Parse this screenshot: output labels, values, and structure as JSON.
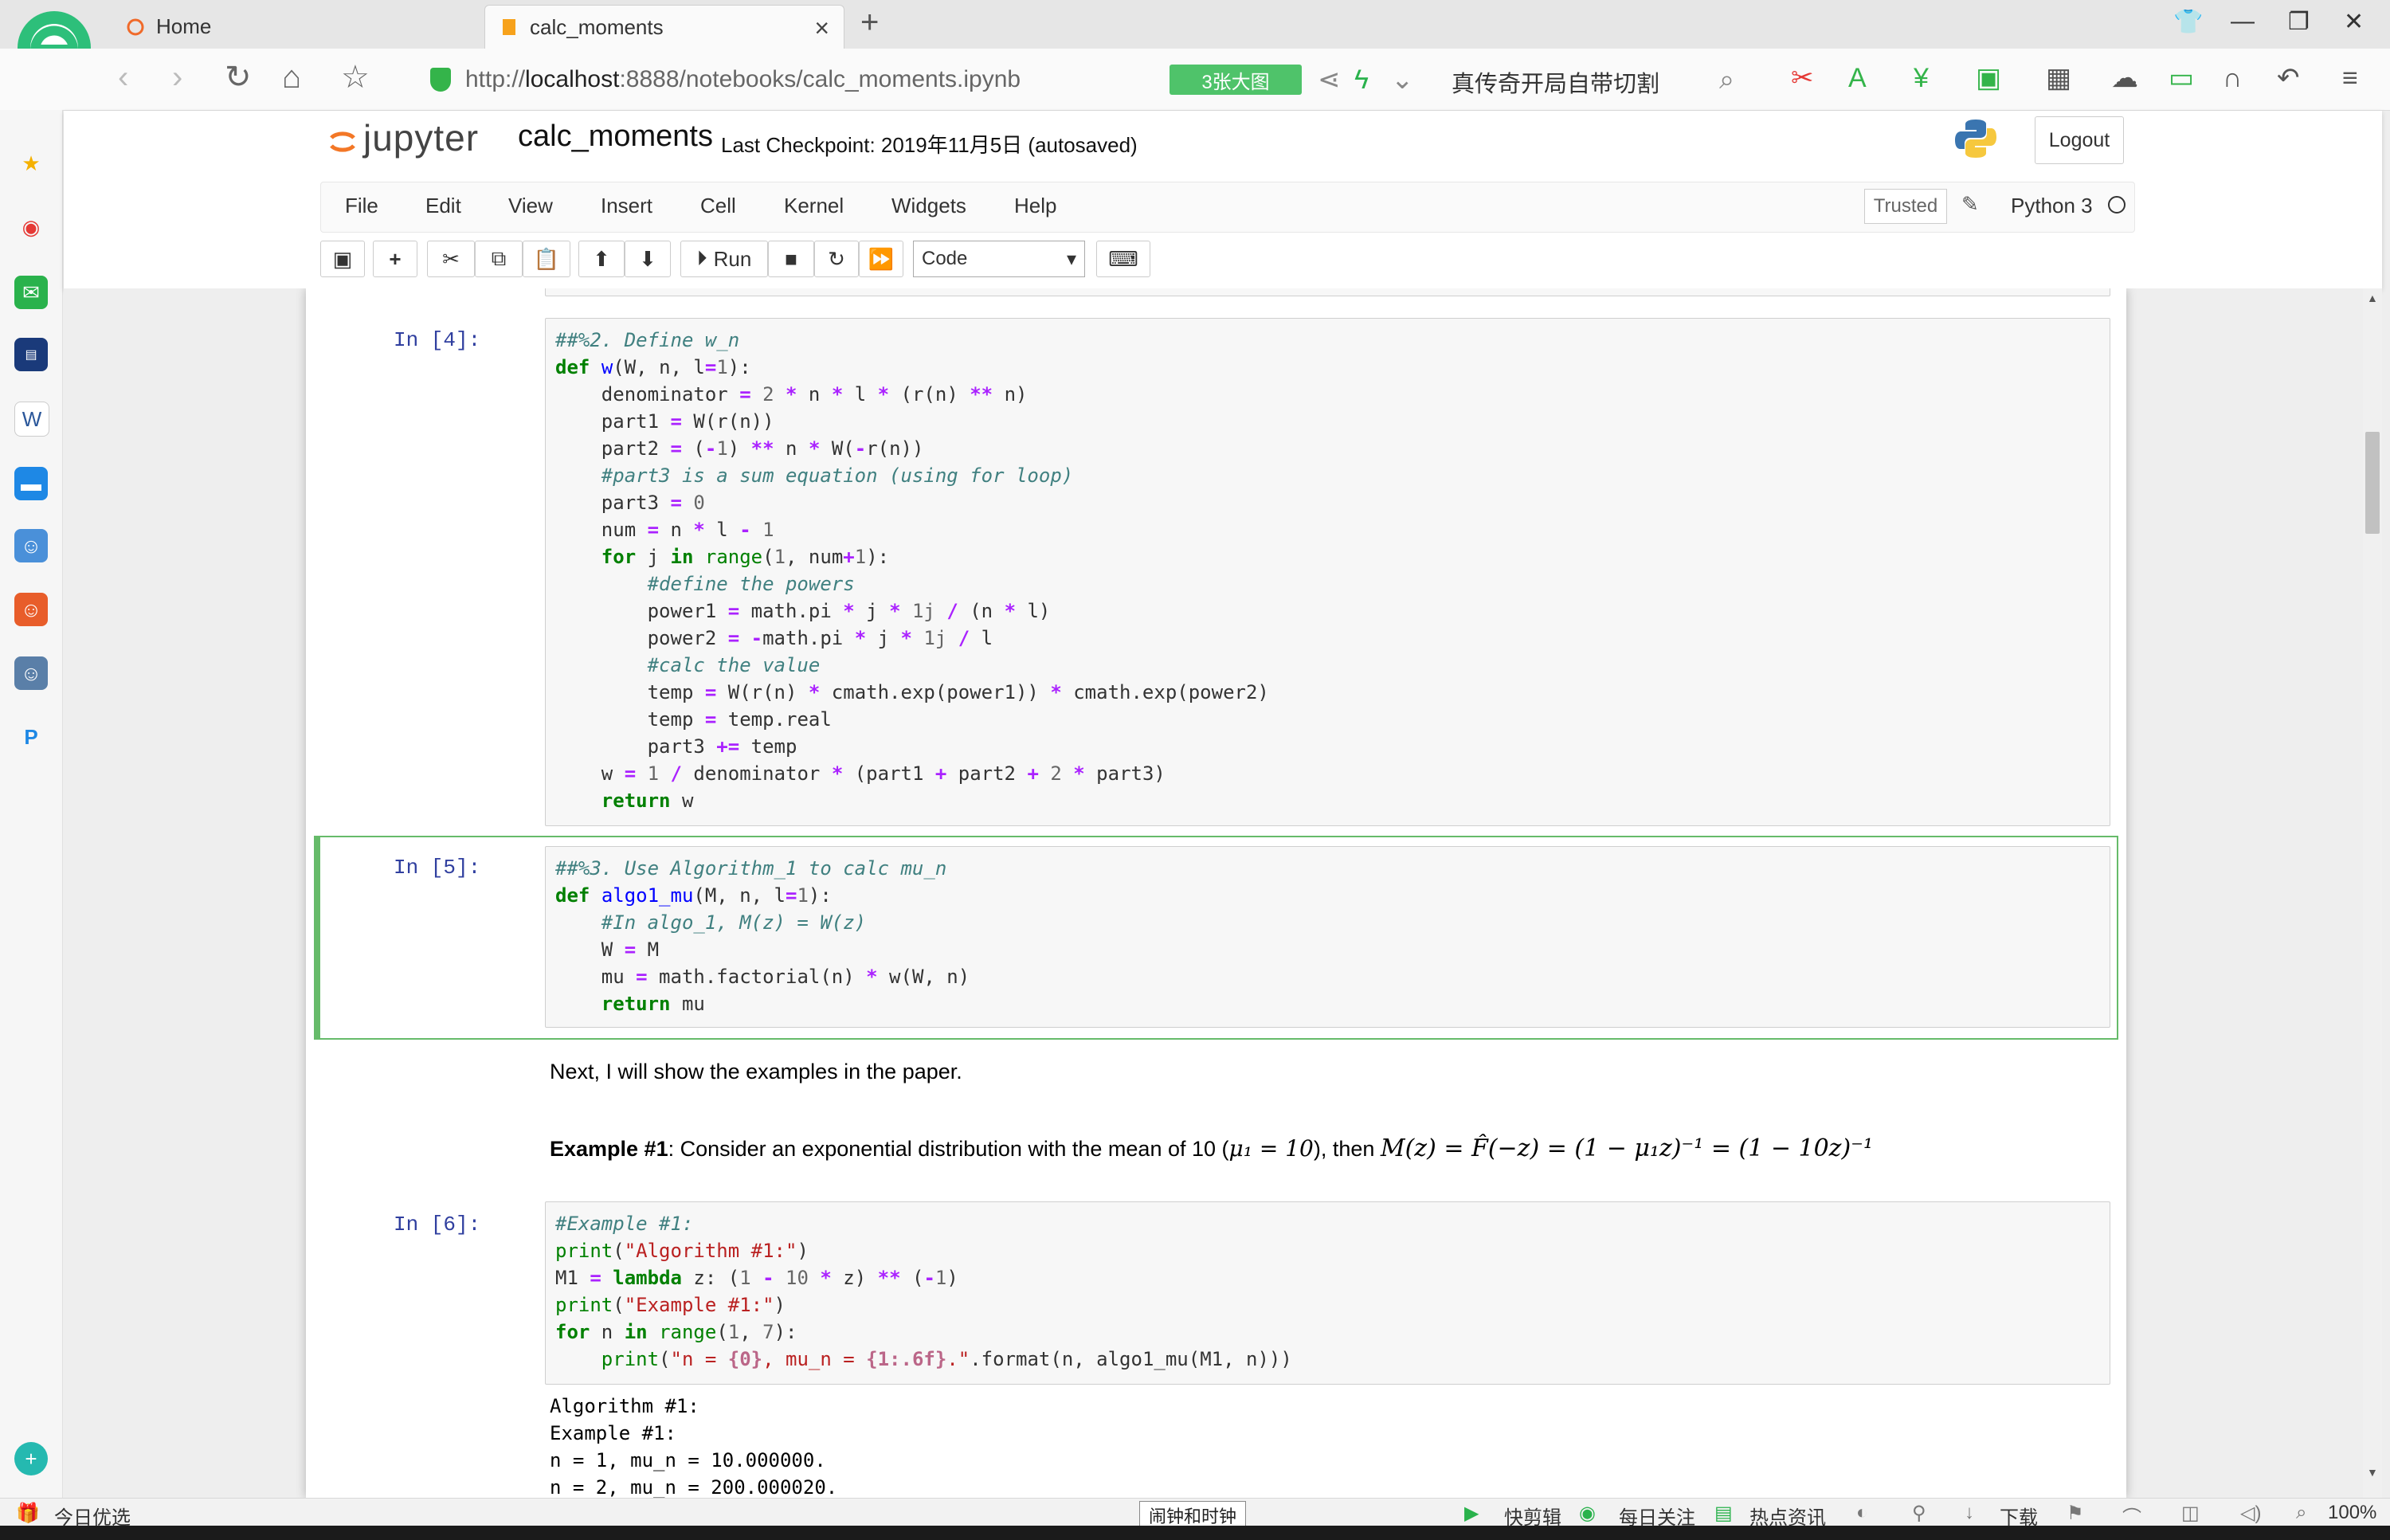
{
  "browser": {
    "tabs": [
      {
        "label": "Home"
      },
      {
        "label": "calc_moments"
      }
    ],
    "url_prefix": "http://",
    "url_host": "localhost",
    "url_rest": ":8888/notebooks/calc_moments.ipynb",
    "image_badge": "3张大图",
    "search_query": "真传奇开局自带切割"
  },
  "jupyter": {
    "logo_text": "jupyter",
    "notebook_name": "calc_moments",
    "checkpoint": "Last Checkpoint: 2019年11月5日   (autosaved)",
    "logout_label": "Logout",
    "menu": [
      "File",
      "Edit",
      "View",
      "Insert",
      "Cell",
      "Kernel",
      "Widgets",
      "Help"
    ],
    "trusted_label": "Trusted",
    "kernel_name": "Python 3",
    "toolbar": {
      "run_label": "Run",
      "cell_type": "Code"
    }
  },
  "cells": {
    "cell4": {
      "prompt": "In [4]:",
      "lines": [
        [
          [
            "c",
            "##%2. Define w_n"
          ]
        ],
        [
          [
            "k",
            "def"
          ],
          [
            "t",
            " "
          ],
          [
            "nf",
            "w"
          ],
          [
            "t",
            "(W, n, l"
          ],
          [
            "o",
            "="
          ],
          [
            "mi",
            "1"
          ],
          [
            "t",
            "):"
          ]
        ],
        [
          [
            "t",
            "    denominator "
          ],
          [
            "o",
            "="
          ],
          [
            "t",
            " "
          ],
          [
            "mi",
            "2"
          ],
          [
            "t",
            " "
          ],
          [
            "o",
            "*"
          ],
          [
            "t",
            " n "
          ],
          [
            "o",
            "*"
          ],
          [
            "t",
            " l "
          ],
          [
            "o",
            "*"
          ],
          [
            "t",
            " (r(n) "
          ],
          [
            "o",
            "**"
          ],
          [
            "t",
            " n)"
          ]
        ],
        [
          [
            "t",
            "    part1 "
          ],
          [
            "o",
            "="
          ],
          [
            "t",
            " W(r(n))"
          ]
        ],
        [
          [
            "t",
            "    part2 "
          ],
          [
            "o",
            "="
          ],
          [
            "t",
            " ("
          ],
          [
            "o",
            "-"
          ],
          [
            "mi",
            "1"
          ],
          [
            "t",
            ") "
          ],
          [
            "o",
            "**"
          ],
          [
            "t",
            " n "
          ],
          [
            "o",
            "*"
          ],
          [
            "t",
            " W("
          ],
          [
            "o",
            "-"
          ],
          [
            "t",
            "r(n))"
          ]
        ],
        [
          [
            "t",
            "    "
          ],
          [
            "c",
            "#part3 is a sum equation (using for loop)"
          ]
        ],
        [
          [
            "t",
            "    part3 "
          ],
          [
            "o",
            "="
          ],
          [
            "t",
            " "
          ],
          [
            "mi",
            "0"
          ]
        ],
        [
          [
            "t",
            "    num "
          ],
          [
            "o",
            "="
          ],
          [
            "t",
            " n "
          ],
          [
            "o",
            "*"
          ],
          [
            "t",
            " l "
          ],
          [
            "o",
            "-"
          ],
          [
            "t",
            " "
          ],
          [
            "mi",
            "1"
          ]
        ],
        [
          [
            "t",
            "    "
          ],
          [
            "k",
            "for"
          ],
          [
            "t",
            " j "
          ],
          [
            "k",
            "in"
          ],
          [
            "t",
            " "
          ],
          [
            "nb",
            "range"
          ],
          [
            "t",
            "("
          ],
          [
            "mi",
            "1"
          ],
          [
            "t",
            ", num"
          ],
          [
            "o",
            "+"
          ],
          [
            "mi",
            "1"
          ],
          [
            "t",
            "):"
          ]
        ],
        [
          [
            "t",
            "        "
          ],
          [
            "c",
            "#define the powers"
          ]
        ],
        [
          [
            "t",
            "        power1 "
          ],
          [
            "o",
            "="
          ],
          [
            "t",
            " math.pi "
          ],
          [
            "o",
            "*"
          ],
          [
            "t",
            " j "
          ],
          [
            "o",
            "*"
          ],
          [
            "t",
            " "
          ],
          [
            "mi",
            "1j"
          ],
          [
            "t",
            " "
          ],
          [
            "o",
            "/"
          ],
          [
            "t",
            " (n "
          ],
          [
            "o",
            "*"
          ],
          [
            "t",
            " l)"
          ]
        ],
        [
          [
            "t",
            "        power2 "
          ],
          [
            "o",
            "="
          ],
          [
            "t",
            " "
          ],
          [
            "o",
            "-"
          ],
          [
            "t",
            "math.pi "
          ],
          [
            "o",
            "*"
          ],
          [
            "t",
            " j "
          ],
          [
            "o",
            "*"
          ],
          [
            "t",
            " "
          ],
          [
            "mi",
            "1j"
          ],
          [
            "t",
            " "
          ],
          [
            "o",
            "/"
          ],
          [
            "t",
            " l"
          ]
        ],
        [
          [
            "t",
            "        "
          ],
          [
            "c",
            "#calc the value"
          ]
        ],
        [
          [
            "t",
            "        temp "
          ],
          [
            "o",
            "="
          ],
          [
            "t",
            " W(r(n) "
          ],
          [
            "o",
            "*"
          ],
          [
            "t",
            " cmath.exp(power1)) "
          ],
          [
            "o",
            "*"
          ],
          [
            "t",
            " cmath.exp(power2)"
          ]
        ],
        [
          [
            "t",
            "        temp "
          ],
          [
            "o",
            "="
          ],
          [
            "t",
            " temp.real"
          ]
        ],
        [
          [
            "t",
            "        part3 "
          ],
          [
            "o",
            "+="
          ],
          [
            "t",
            " temp"
          ]
        ],
        [
          [
            "t",
            "    w "
          ],
          [
            "o",
            "="
          ],
          [
            "t",
            " "
          ],
          [
            "mi",
            "1"
          ],
          [
            "t",
            " "
          ],
          [
            "o",
            "/"
          ],
          [
            "t",
            " denominator "
          ],
          [
            "o",
            "*"
          ],
          [
            "t",
            " (part1 "
          ],
          [
            "o",
            "+"
          ],
          [
            "t",
            " part2 "
          ],
          [
            "o",
            "+"
          ],
          [
            "t",
            " "
          ],
          [
            "mi",
            "2"
          ],
          [
            "t",
            " "
          ],
          [
            "o",
            "*"
          ],
          [
            "t",
            " part3)"
          ]
        ],
        [
          [
            "t",
            "    "
          ],
          [
            "k",
            "return"
          ],
          [
            "t",
            " w"
          ]
        ]
      ]
    },
    "cell5": {
      "prompt": "In [5]:",
      "lines": [
        [
          [
            "c",
            "##%3. Use Algorithm_1 to calc mu_n"
          ]
        ],
        [
          [
            "k",
            "def"
          ],
          [
            "t",
            " "
          ],
          [
            "nf",
            "algo1_mu"
          ],
          [
            "t",
            "(M, n, l"
          ],
          [
            "o",
            "="
          ],
          [
            "mi",
            "1"
          ],
          [
            "t",
            "):"
          ]
        ],
        [
          [
            "t",
            "    "
          ],
          [
            "c",
            "#In algo_1, M(z) = W(z)"
          ]
        ],
        [
          [
            "t",
            "    W "
          ],
          [
            "o",
            "="
          ],
          [
            "t",
            " M"
          ]
        ],
        [
          [
            "t",
            "    mu "
          ],
          [
            "o",
            "="
          ],
          [
            "t",
            " math.factorial(n) "
          ],
          [
            "o",
            "*"
          ],
          [
            "t",
            " w(W, n)"
          ]
        ],
        [
          [
            "t",
            "    "
          ],
          [
            "k",
            "return"
          ],
          [
            "t",
            " mu"
          ]
        ]
      ]
    },
    "markdown": {
      "paragraph": "Next, I will show the examples in the paper.",
      "example_bold": "Example #1",
      "example_text": ": Consider an exponential distribution with the mean of 10 (",
      "example_mid": "), then ",
      "mu_expr": "μ₁ = 10",
      "formula": "M(z) = F̂(−z) = (1 − μ₁z)⁻¹ = (1 − 10z)⁻¹"
    },
    "cell6": {
      "prompt": "In [6]:",
      "lines": [
        [
          [
            "c",
            "#Example #1:"
          ]
        ],
        [
          [
            "nb",
            "print"
          ],
          [
            "t",
            "("
          ],
          [
            "s",
            "\"Algorithm #1:\""
          ],
          [
            "t",
            ")"
          ]
        ],
        [
          [
            "t",
            "M1 "
          ],
          [
            "o",
            "="
          ],
          [
            "t",
            " "
          ],
          [
            "k",
            "lambda"
          ],
          [
            "t",
            " z: ("
          ],
          [
            "mi",
            "1"
          ],
          [
            "t",
            " "
          ],
          [
            "o",
            "-"
          ],
          [
            "t",
            " "
          ],
          [
            "mi",
            "10"
          ],
          [
            "t",
            " "
          ],
          [
            "o",
            "*"
          ],
          [
            "t",
            " z) "
          ],
          [
            "o",
            "**"
          ],
          [
            "t",
            " ("
          ],
          [
            "o",
            "-"
          ],
          [
            "mi",
            "1"
          ],
          [
            "t",
            ")"
          ]
        ],
        [
          [
            "nb",
            "print"
          ],
          [
            "t",
            "("
          ],
          [
            "s",
            "\"Example #1:\""
          ],
          [
            "t",
            ")"
          ]
        ],
        [
          [
            "k",
            "for"
          ],
          [
            "t",
            " n "
          ],
          [
            "k",
            "in"
          ],
          [
            "t",
            " "
          ],
          [
            "nb",
            "range"
          ],
          [
            "t",
            "("
          ],
          [
            "mi",
            "1"
          ],
          [
            "t",
            ", "
          ],
          [
            "mi",
            "7"
          ],
          [
            "t",
            "):"
          ]
        ],
        [
          [
            "t",
            "    "
          ],
          [
            "nb",
            "print"
          ],
          [
            "t",
            "("
          ],
          [
            "s",
            "\"n = "
          ],
          [
            "si",
            "{0}"
          ],
          [
            "s",
            ", mu_n = "
          ],
          [
            "si",
            "{1:.6f}"
          ],
          [
            "s",
            ".\""
          ],
          [
            "t",
            ".format(n, algo1_mu(M1, n)))"
          ]
        ]
      ],
      "output": [
        "Algorithm #1:",
        "Example #1:",
        "n = 1, mu_n = 10.000000.",
        "n = 2, mu_n = 200.000020."
      ]
    }
  },
  "statusbar": {
    "left_label": "今日优选",
    "tooltip": "闹钟和时钟",
    "items": [
      "快剪辑",
      "每日关注",
      "热点资讯"
    ],
    "download_label": "下载",
    "zoom": "100%"
  },
  "icons": [
    "browser-logo-icon",
    "star-icon",
    "weibo-icon",
    "mail-icon",
    "python-logo-icon"
  ]
}
